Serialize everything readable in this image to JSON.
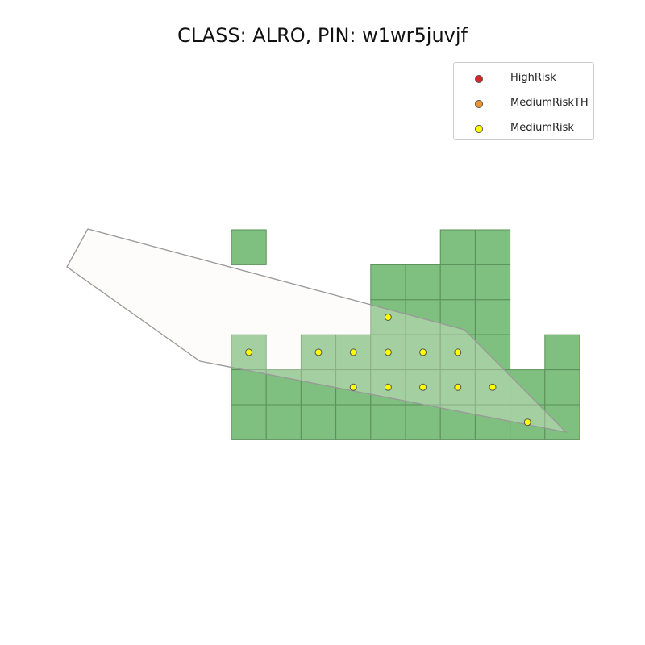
{
  "title": "CLASS: ALRO, PIN: w1wr5juvjf",
  "colors": {
    "cell_fill": "#7fbf7f",
    "cell_stroke": "#5a8f5a",
    "polygon_fill": "#fdf5f0",
    "polygon_stroke": "#999999",
    "point_medium": "#ffff00",
    "point_high": "#d62728",
    "point_medium_th": "#f0932b"
  },
  "legend": {
    "items": [
      {
        "label": "HighRisk",
        "color": "#d62728",
        "icon": "red-dot"
      },
      {
        "label": "MediumRiskTH",
        "color": "#f0932b",
        "icon": "orange-dot"
      },
      {
        "label": "MediumRisk",
        "color": "#ffff00",
        "icon": "yellow-dot"
      }
    ]
  },
  "grid": {
    "cells": [
      [
        0,
        0
      ],
      [
        6,
        0
      ],
      [
        7,
        0
      ],
      [
        4,
        1
      ],
      [
        5,
        1
      ],
      [
        6,
        1
      ],
      [
        7,
        1
      ],
      [
        4,
        2
      ],
      [
        5,
        2
      ],
      [
        6,
        2
      ],
      [
        7,
        2
      ],
      [
        0,
        3
      ],
      [
        2,
        3
      ],
      [
        3,
        3
      ],
      [
        4,
        3
      ],
      [
        5,
        3
      ],
      [
        6,
        3
      ],
      [
        7,
        3
      ],
      [
        9,
        3
      ],
      [
        0,
        4
      ],
      [
        1,
        4
      ],
      [
        2,
        4
      ],
      [
        3,
        4
      ],
      [
        4,
        4
      ],
      [
        5,
        4
      ],
      [
        6,
        4
      ],
      [
        7,
        4
      ],
      [
        8,
        4
      ],
      [
        9,
        4
      ],
      [
        0,
        5
      ],
      [
        1,
        5
      ],
      [
        2,
        5
      ],
      [
        3,
        5
      ],
      [
        4,
        5
      ],
      [
        5,
        5
      ],
      [
        6,
        5
      ],
      [
        7,
        5
      ],
      [
        8,
        5
      ],
      [
        9,
        5
      ]
    ]
  },
  "points": [
    {
      "col": 4,
      "row": 2,
      "risk": "MediumRisk"
    },
    {
      "col": 0,
      "row": 3,
      "risk": "MediumRisk"
    },
    {
      "col": 2,
      "row": 3,
      "risk": "MediumRisk"
    },
    {
      "col": 3,
      "row": 3,
      "risk": "MediumRisk"
    },
    {
      "col": 4,
      "row": 3,
      "risk": "MediumRisk"
    },
    {
      "col": 5,
      "row": 3,
      "risk": "MediumRisk"
    },
    {
      "col": 6,
      "row": 3,
      "risk": "MediumRisk"
    },
    {
      "col": 3,
      "row": 4,
      "risk": "MediumRisk"
    },
    {
      "col": 4,
      "row": 4,
      "risk": "MediumRisk"
    },
    {
      "col": 5,
      "row": 4,
      "risk": "MediumRisk"
    },
    {
      "col": 6,
      "row": 4,
      "risk": "MediumRisk"
    },
    {
      "col": 7,
      "row": 4,
      "risk": "MediumRisk"
    },
    {
      "col": 8,
      "row": 5,
      "risk": "MediumRisk"
    }
  ]
}
